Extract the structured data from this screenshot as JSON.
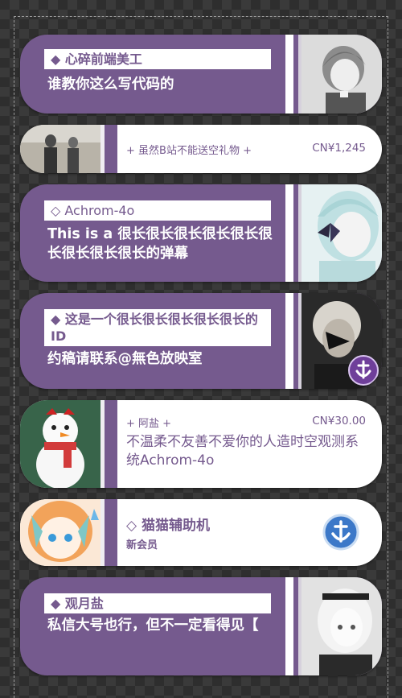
{
  "colors": {
    "accent": "#755a8e",
    "stripe_light": "#d6d1dc",
    "background_check": "#3a3a3a"
  },
  "cards": [
    {
      "type": "superchat",
      "name": "◆ 心碎前端美工",
      "message": "谁教你这么写代码的",
      "avatar_icon": "anime-girl-grey-hair-avatar"
    },
    {
      "type": "gift",
      "user": "+ 虽然B站不能送空礼物 +",
      "price": "CN¥1,245",
      "image_icon": "figures-walking-image"
    },
    {
      "type": "superchat",
      "name": "◇ Achrom-4o",
      "message": "This is a 很长很长很长很长很长很长很长很长很长的弹幕",
      "avatar_icon": "anime-girl-butterfly-avatar"
    },
    {
      "type": "superchat",
      "name": "◆ 这是一个很长很长很长很长很长的ID",
      "message": "约稿请联系@無色放映室",
      "avatar_icon": "masked-girl-avatar",
      "badge_icon": "anchor-badge-icon"
    },
    {
      "type": "gift",
      "user": "+ 阿盐 +",
      "price": "CN¥30.00",
      "message": "不温柔不友善不爱你的人造时空观测系统Achrom-4o",
      "image_icon": "snowman-image"
    },
    {
      "type": "member",
      "name": "◇ 猫猫辅助机",
      "subtitle": "新会员",
      "image_icon": "chibi-girl-image",
      "badge_icon": "anchor-badge-icon"
    },
    {
      "type": "superchat",
      "name": "◆ 观月盐",
      "message": "私信大号也行，但不一定看得见【",
      "avatar_icon": "white-hair-girl-avatar"
    }
  ]
}
